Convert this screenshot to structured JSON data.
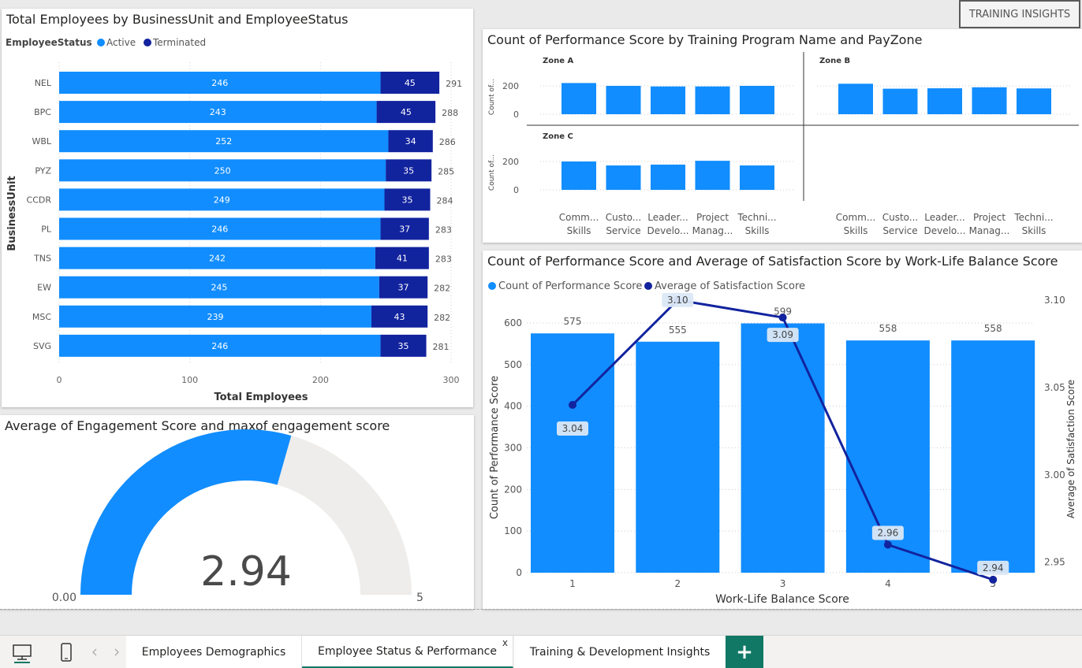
{
  "insights_label": "TRAINING INSIGHTS",
  "employees_chart": {
    "title": "Total Employees by BusinessUnit and EmployeeStatus",
    "legend_title": "EmployeeStatus",
    "xlabel": "Total Employees",
    "ylabel": "BusinessUnit",
    "colors": {
      "Active": "#118dff",
      "Terminated": "#12239e"
    }
  },
  "training_chart": {
    "title": "Count of Performance Score by Training Program Name and PayZone",
    "ylabel": "Count of...",
    "zones": [
      "Zone A",
      "Zone B",
      "Zone C"
    ],
    "category_labels": [
      [
        "Comm...",
        "Skills"
      ],
      [
        "Custo...",
        "Service"
      ],
      [
        "Leader...",
        "Develo..."
      ],
      [
        "Project",
        "Manag..."
      ],
      [
        "Techni...",
        "Skills"
      ]
    ]
  },
  "worklife_chart": {
    "title": "Count of Performance Score and Average of Satisfaction Score by Work-Life Balance Score"
  },
  "gauge_chart": {
    "title": "Average of Engagement Score and maxof engagement score",
    "value_label": "2.94",
    "min_label": "0.00",
    "max_label": "5"
  },
  "tabs": [
    {
      "label": "Employees Demographics",
      "active": false
    },
    {
      "label": "Employee Status & Performance",
      "active": true,
      "close": "x"
    },
    {
      "label": "Training & Development Insights",
      "active": false
    }
  ],
  "add_tab_label": "+",
  "chart_data": [
    {
      "type": "bar",
      "orientation": "horizontal-stacked",
      "title": "Total Employees by BusinessUnit and EmployeeStatus",
      "categories": [
        "NEL",
        "BPC",
        "WBL",
        "PYZ",
        "CCDR",
        "PL",
        "TNS",
        "EW",
        "MSC",
        "SVG"
      ],
      "series": [
        {
          "name": "Active",
          "values": [
            246,
            243,
            252,
            250,
            249,
            246,
            242,
            245,
            239,
            246
          ]
        },
        {
          "name": "Terminated",
          "values": [
            45,
            45,
            34,
            35,
            35,
            37,
            41,
            37,
            43,
            35
          ]
        }
      ],
      "totals": [
        291,
        288,
        286,
        285,
        284,
        283,
        283,
        282,
        282,
        281
      ],
      "xlabel": "Total Employees",
      "ylabel": "BusinessUnit",
      "xlim": [
        0,
        300
      ],
      "xticks": [
        0,
        100,
        200,
        300
      ],
      "legend_position": "top-left"
    },
    {
      "type": "bar",
      "title": "Count of Performance Score by Training Program Name and PayZone",
      "categories": [
        "Comm... Skills",
        "Custo... Service",
        "Leader... Develo...",
        "Project Manag...",
        "Techni... Skills"
      ],
      "panels": [
        {
          "zone": "Zone A",
          "values": [
            220,
            200,
            196,
            196,
            200
          ]
        },
        {
          "zone": "Zone B",
          "values": [
            215,
            180,
            183,
            190,
            182
          ]
        },
        {
          "zone": "Zone C",
          "values": [
            200,
            172,
            178,
            205,
            172
          ]
        }
      ],
      "ylabel": "Count of...",
      "yticks": [
        0,
        200
      ],
      "ylim": [
        0,
        300
      ]
    },
    {
      "type": "bar",
      "combo": "bar-line",
      "title": "Count of Performance Score and Average of Satisfaction Score by Work-Life Balance Score",
      "categories": [
        "1",
        "2",
        "3",
        "4",
        "5"
      ],
      "series": [
        {
          "name": "Count of Performance Score",
          "type": "bar",
          "values": [
            575,
            555,
            599,
            558,
            558
          ]
        },
        {
          "name": "Average of Satisfaction Score",
          "type": "line",
          "axis": "right",
          "values": [
            3.04,
            3.1,
            3.09,
            2.96,
            2.94
          ]
        }
      ],
      "xlabel": "Work-Life Balance Score",
      "ylabel": "Count of Performance Score",
      "ylabel_right": "Average of Satisfaction Score",
      "ylim": [
        0,
        640
      ],
      "yticks": [
        0,
        100,
        200,
        300,
        400,
        500,
        600
      ],
      "ylim_right": [
        2.944,
        3.104
      ],
      "yticks_right": [
        "2.95",
        "3.00",
        "3.05",
        "3.10"
      ],
      "legend_position": "top-left"
    },
    {
      "type": "gauge",
      "title": "Average of Engagement Score and maxof engagement score",
      "value": 2.94,
      "min": 0,
      "max": 5
    }
  ]
}
